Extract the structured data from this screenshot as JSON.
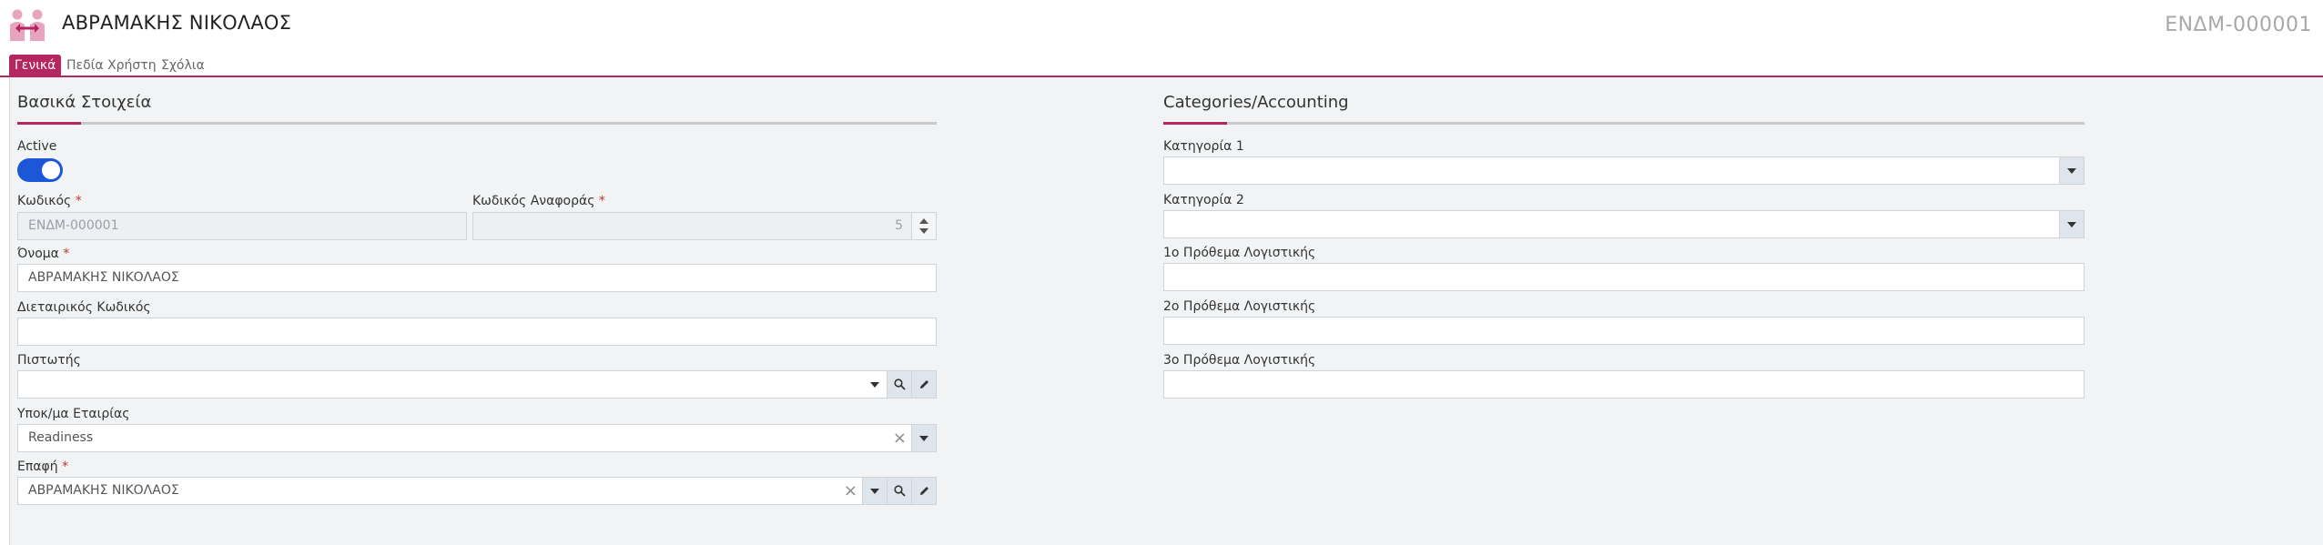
{
  "header": {
    "title": "ΑΒΡΑΜΑΚΗΣ ΝΙΚΟΛΑΟΣ",
    "document_number": "ΕΝΔΜ-000001",
    "logo_icon": "people-handshake-icon"
  },
  "tabs": [
    {
      "label": "Γενικά",
      "active": true
    },
    {
      "label": "Πεδία Χρήστη",
      "active": false
    },
    {
      "label": "Σχόλια",
      "active": false
    }
  ],
  "colors": {
    "accent": "#b5255f",
    "toggle": "#1c57d8"
  },
  "basic": {
    "section_title": "Βασικά Στοιχεία",
    "active_label": "Active",
    "active_value": true,
    "code_label": "Κωδικός",
    "code_value": "ΕΝΔΜ-000001",
    "ref_code_label": "Κωδικός Αναφοράς",
    "ref_code_value": "5",
    "name_label": "Όνομα",
    "name_value": "ΑΒΡΑΜΑΚΗΣ ΝΙΚΟΛΑΟΣ",
    "intercompany_label": "Διεταιρικός Κωδικός",
    "intercompany_value": "",
    "creditor_label": "Πιστωτής",
    "creditor_value": "",
    "branch_label": "Υποκ/μα Εταιρίας",
    "branch_value": "Readiness",
    "contact_label": "Επαφή",
    "contact_value": "ΑΒΡΑΜΑΚΗΣ ΝΙΚΟΛΑΟΣ",
    "required_mark": "*",
    "clear_glyph": "×"
  },
  "categories": {
    "section_title": "Categories/Accounting",
    "category1_label": "Κατηγορία 1",
    "category1_value": "",
    "category2_label": "Κατηγορία 2",
    "category2_value": "",
    "prefix1_label": "1ο Πρόθεμα Λογιστικής",
    "prefix1_value": "",
    "prefix2_label": "2ο Πρόθεμα Λογιστικής",
    "prefix2_value": "",
    "prefix3_label": "3ο Πρόθεμα Λογιστικής",
    "prefix3_value": ""
  }
}
